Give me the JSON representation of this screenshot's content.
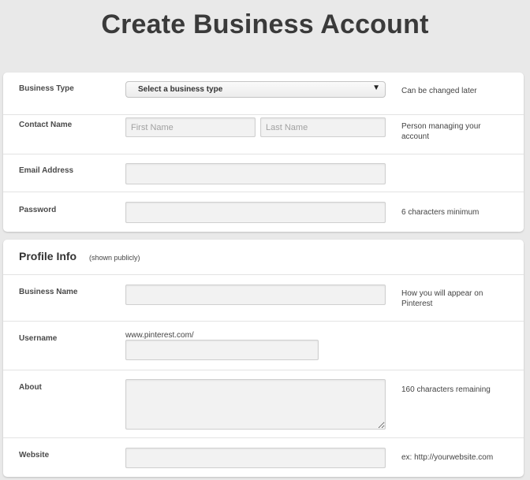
{
  "page": {
    "title": "Create Business Account"
  },
  "account": {
    "business_type": {
      "label": "Business Type",
      "selected": "Select a business type",
      "hint": "Can be changed later"
    },
    "contact_name": {
      "label": "Contact Name",
      "first_placeholder": "First Name",
      "last_placeholder": "Last Name",
      "hint": "Person managing your account"
    },
    "email": {
      "label": "Email Address"
    },
    "password": {
      "label": "Password",
      "hint": "6 characters minimum"
    }
  },
  "profile": {
    "title": "Profile Info",
    "subtitle": "(shown publicly)",
    "business_name": {
      "label": "Business Name",
      "hint": "How you will appear on Pinterest"
    },
    "username": {
      "label": "Username",
      "prefix": "www.pinterest.com/"
    },
    "about": {
      "label": "About",
      "hint": "160 characters remaining"
    },
    "website": {
      "label": "Website",
      "hint": "ex: http://yourwebsite.com"
    }
  }
}
